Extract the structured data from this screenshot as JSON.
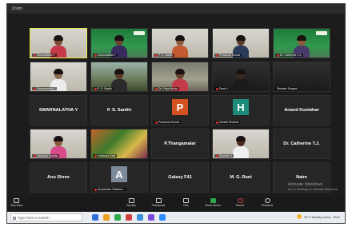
{
  "window": {
    "title": "Zoom"
  },
  "rows": [
    [
      {
        "kind": "video",
        "style": "light",
        "name": "Swarnalatha Y",
        "active": true,
        "skin": "#7a4a30",
        "shirt": "#c43a48"
      },
      {
        "kind": "video",
        "style": "green",
        "name": "Swarnalatha Y",
        "skin": "#6a4030",
        "shirt": "#3a2a60",
        "banner": true
      },
      {
        "kind": "video",
        "style": "light",
        "name": "P. S. Santhi",
        "skin": "#8a5a3c",
        "shirt": "#c45a30"
      },
      {
        "kind": "video",
        "style": "light",
        "name": "Pravanna Kumar",
        "skin": "#5a3a2a",
        "shirt": "#2a3a5a"
      },
      {
        "kind": "video",
        "style": "green",
        "name": "Dr. Catherine T.J.",
        "skin": "#8a5a3c",
        "shirt": "#4a3a6a",
        "banner": true
      }
    ],
    [
      {
        "kind": "video",
        "style": "light",
        "name": "Swarnalatha Y",
        "skin": "#8a6a50",
        "shirt": "#ececec"
      },
      {
        "kind": "video",
        "style": "outdoor",
        "name": "P. S. Santhi",
        "skin": "#5a3a2a",
        "shirt": "#2a2a2a"
      },
      {
        "kind": "video",
        "style": "room",
        "name": "Dr. Priya Muthu",
        "skin": "#6a4030",
        "shirt": "#c43a48"
      },
      {
        "kind": "video",
        "style": "dark",
        "name": "David J",
        "skin": "#3a2a20",
        "shirt": "#1a1a1a"
      },
      {
        "kind": "empty",
        "name": "Rishabh Singhal"
      }
    ],
    [
      {
        "kind": "text",
        "label": "SWARNALATHA Y"
      },
      {
        "kind": "text",
        "label": "P. S. Santhi"
      },
      {
        "kind": "avatar",
        "letter": "P",
        "color": "orange",
        "name": "Pravanna Kumar"
      },
      {
        "kind": "avatar",
        "letter": "H",
        "color": "teal",
        "name": "Harshit Sharma"
      },
      {
        "kind": "text",
        "label": "Anand Kumbhar"
      }
    ],
    [
      {
        "kind": "video",
        "style": "light",
        "name": "Sandhya Gowda",
        "skin": "#8a5a3c",
        "shirt": "#d84a8a"
      },
      {
        "kind": "video",
        "style": "colorful",
        "name": "Kalaivani Devi",
        "noperson": true
      },
      {
        "kind": "text",
        "label": "P.Thangamalar"
      },
      {
        "kind": "video",
        "style": "light",
        "name": "Ramesh S",
        "skin": "#4a2a1a",
        "shirt": "#f0f0f0"
      },
      {
        "kind": "text",
        "label": "Dr. Catherine T.J."
      }
    ],
    [
      {
        "kind": "text",
        "label": "Anu Shree"
      },
      {
        "kind": "avatar",
        "letter": "A",
        "color": "gray",
        "name": "Arulselvam Shanmu..."
      },
      {
        "kind": "text",
        "label": "Galaxy F41"
      },
      {
        "kind": "text",
        "label": "M. G. Rani"
      },
      {
        "kind": "text",
        "label": "Naim"
      }
    ]
  ],
  "watermark": {
    "title": "Activate Windows",
    "subtitle": "Go to Settings to activate Windows."
  },
  "toolbar": {
    "video": "Stop Video",
    "items": [
      "Security",
      "Participants",
      "Chat",
      "Share Screen",
      "Record",
      "Reactions"
    ],
    "share_green": true
  },
  "taskbar": {
    "search": "Type here to search",
    "weather": "34°C  Mostly sunny",
    "lang": "ENG",
    "icons": [
      "#2f6fd6",
      "#e8a020",
      "#2fa84a",
      "#d04040",
      "#3a8fd8",
      "#7a4ad8",
      "#2d8cff"
    ]
  }
}
